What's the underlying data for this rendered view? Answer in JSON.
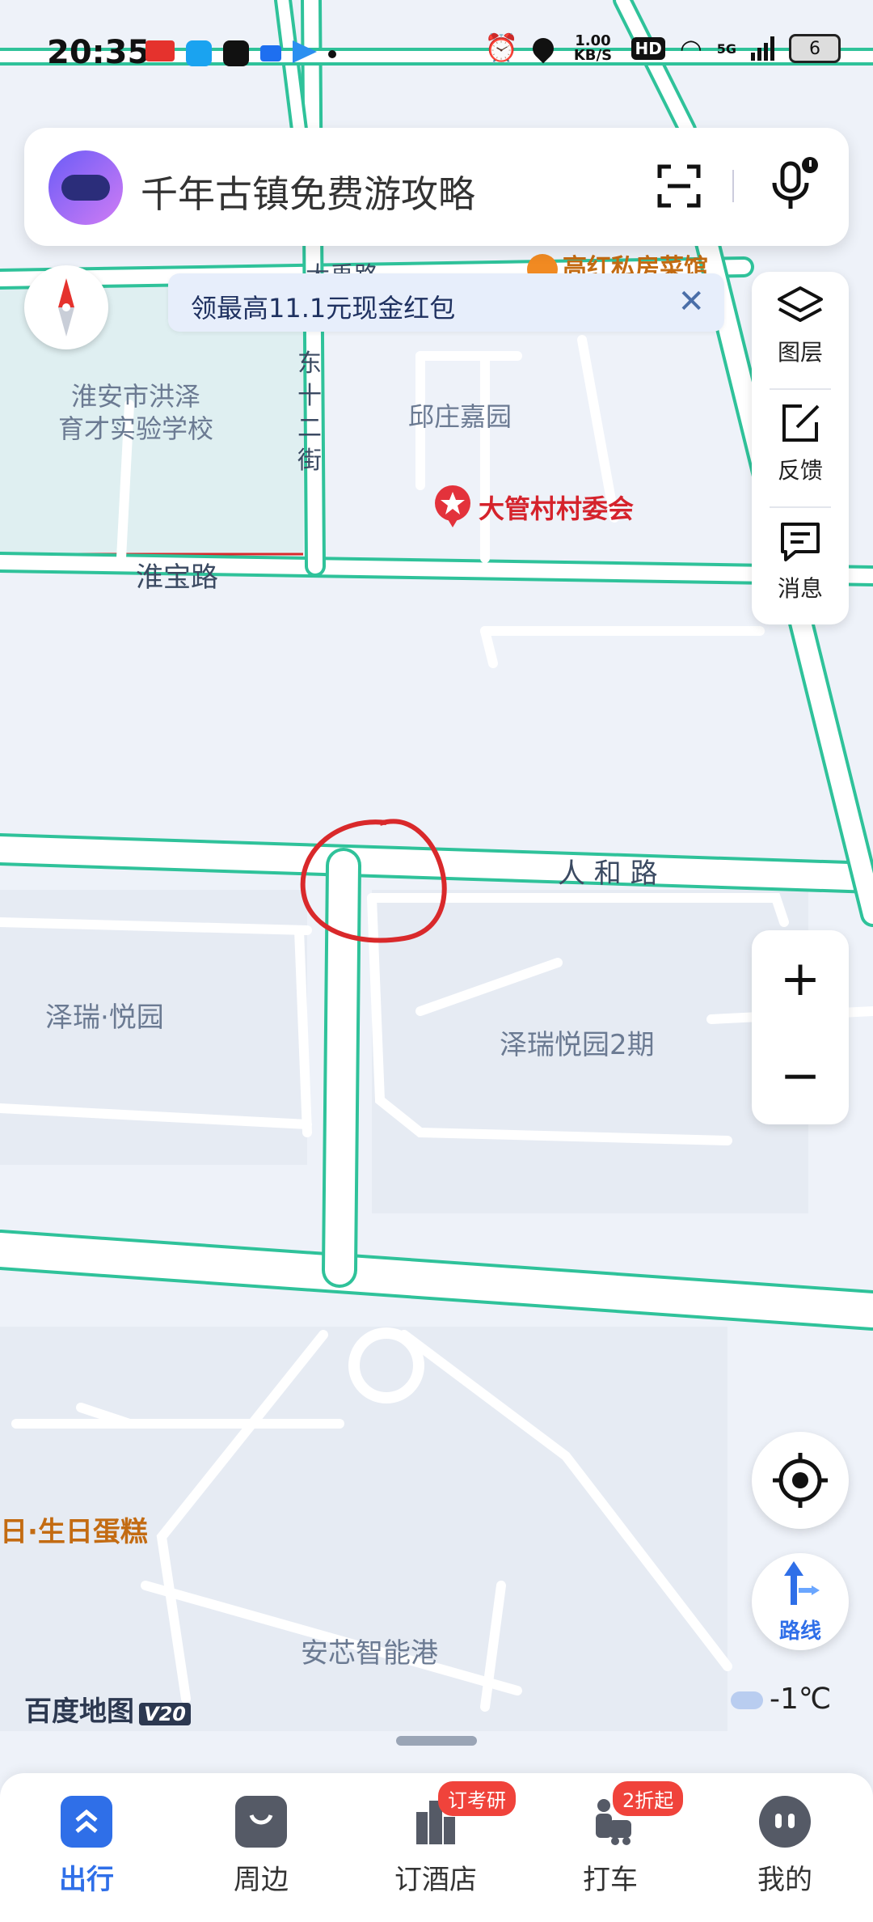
{
  "status_bar": {
    "time": "20:35",
    "net_speed": "1.00 KB/S",
    "hd": "HD",
    "signal": "5G",
    "battery": "6"
  },
  "search": {
    "placeholder_text": "千年古镇免费游攻略"
  },
  "banner": {
    "text": "领最高11.1元现金红包",
    "close": "✕"
  },
  "side_panel": {
    "layers": "图层",
    "feedback": "反馈",
    "messages": "消息"
  },
  "zoom": {
    "in": "+",
    "out": "−"
  },
  "route": {
    "label": "路线"
  },
  "map": {
    "labels": {
      "school": "淮安市洪泽\n育才实验学校",
      "qiuzhuang": "邱庄嘉园",
      "daguan": "大管村村委会",
      "dong12": "东\n十\n二\n街",
      "huaibao": "淮宝路",
      "renhe": "人 和 路",
      "zerui": "泽瑞·悦园",
      "zerui2": "泽瑞悦园2期",
      "cake": "日·生日蛋糕",
      "anxin": "安芯智能港",
      "restaurant": "高红私房菜馆",
      "top_road": "大禹路"
    }
  },
  "branding": {
    "logo": "百度地图",
    "version": "V20"
  },
  "weather": {
    "temp": "-1℃"
  },
  "bottom_nav": {
    "items": [
      {
        "label": "出行",
        "badge": ""
      },
      {
        "label": "周边",
        "badge": ""
      },
      {
        "label": "订酒店",
        "badge": "订考研"
      },
      {
        "label": "打车",
        "badge": "2折起"
      },
      {
        "label": "我的",
        "badge": ""
      }
    ]
  },
  "colors": {
    "road_edge": "#2fc29a",
    "accent": "#2f6fe8",
    "badge": "#f0433b",
    "annotation": "#d9292b"
  }
}
